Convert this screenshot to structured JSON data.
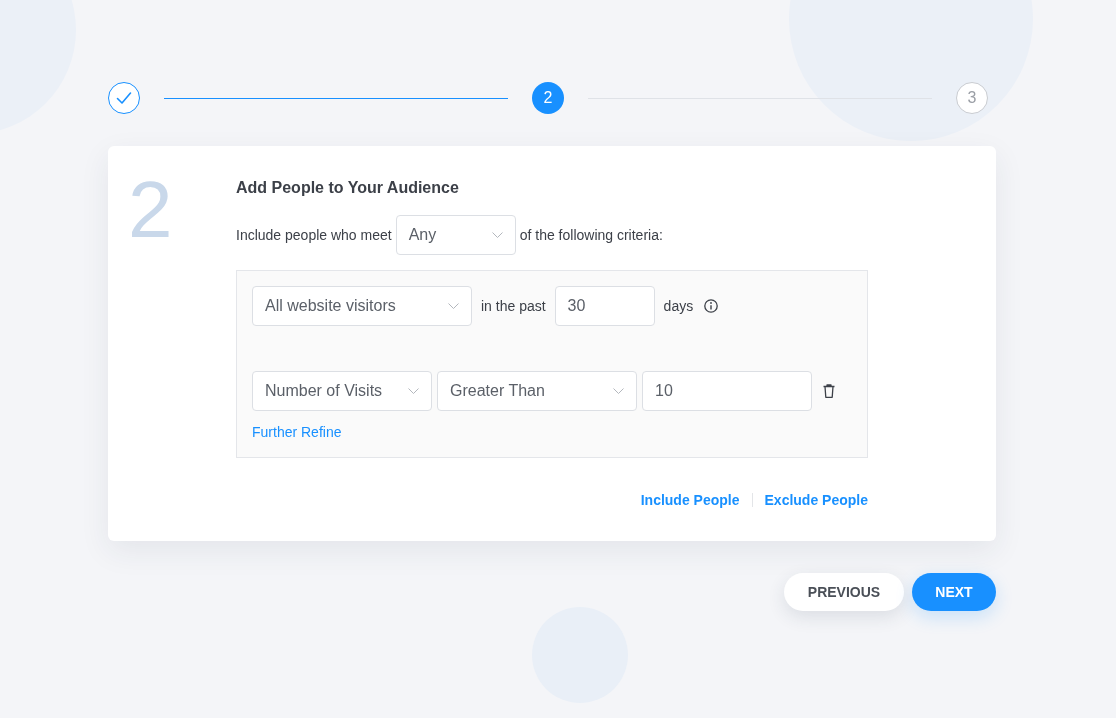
{
  "steps": [
    {
      "completed": true,
      "selected": false
    },
    {
      "label": "2",
      "completed": false,
      "selected": true
    },
    {
      "label": "3",
      "completed": false,
      "selected": false
    }
  ],
  "card": {
    "step_number": "2",
    "title": "Add People to Your Audience",
    "match": {
      "label_before": "Include people who meet",
      "select": "Any",
      "label_after": "of the following criteria:"
    },
    "criteria": {
      "audience_select": "All website visitors",
      "range_label": "in the past",
      "days_value": "30",
      "days_label": "days",
      "rules": [
        {
          "metric": "Number of Visits",
          "operator": "Greater Than",
          "value": "10"
        }
      ],
      "further_refine": "Further Refine"
    },
    "actions": [
      "Include People",
      "Exclude People"
    ]
  },
  "buttons": [
    {
      "label": "PREVIOUS",
      "kind": "secondary"
    },
    {
      "label": "NEXT",
      "kind": "primary"
    }
  ]
}
